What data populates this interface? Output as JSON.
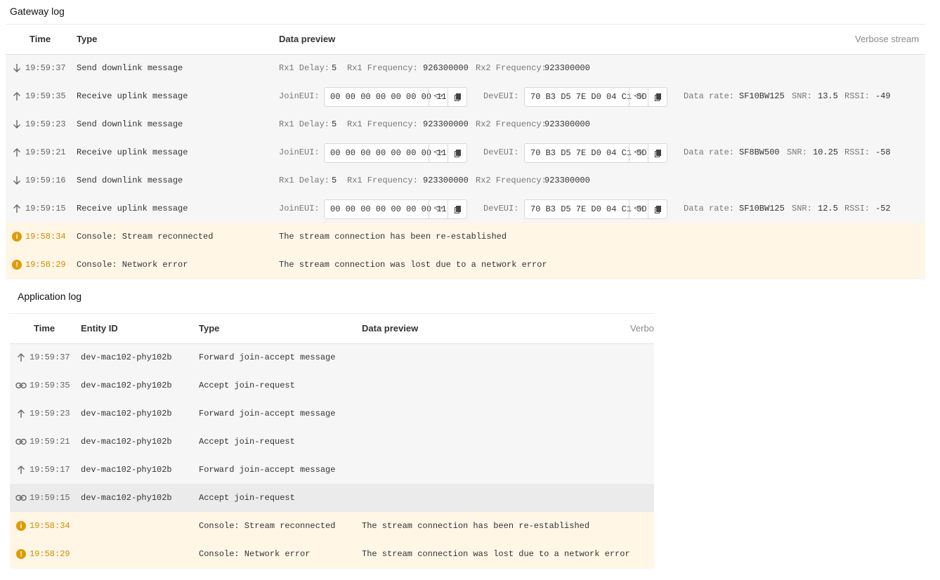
{
  "gateway": {
    "title": "Gateway log",
    "headers": {
      "time": "Time",
      "type": "Type",
      "preview": "Data preview",
      "verbose": "Verbose stream"
    },
    "rows": [
      {
        "icon": "arrow-down-icon",
        "time": "19:59:37",
        "type": "Send downlink message",
        "kind": "down",
        "p": [
          "Rx1 Delay:",
          "5",
          "Rx1 Frequency:",
          "926300000",
          "Rx2 Frequency:",
          "923300000"
        ]
      },
      {
        "icon": "arrow-up-icon",
        "time": "19:59:35",
        "type": "Receive uplink message",
        "kind": "up",
        "join_label": "JoinEUI:",
        "join": "00 00 00 00 00 00 00 11",
        "dev_label": "DevEUI:",
        "dev": "70 B3 D5 7E D0 04 C1 5D",
        "p": [
          "Data rate:",
          "SF10BW125",
          "SNR:",
          "13.5",
          "RSSI:",
          "-49"
        ]
      },
      {
        "icon": "arrow-down-icon",
        "time": "19:59:23",
        "type": "Send downlink message",
        "kind": "down",
        "p": [
          "Rx1 Delay:",
          "5",
          "Rx1 Frequency:",
          "923300000",
          "Rx2 Frequency:",
          "923300000"
        ]
      },
      {
        "icon": "arrow-up-icon",
        "time": "19:59:21",
        "type": "Receive uplink message",
        "kind": "up",
        "join_label": "JoinEUI:",
        "join": "00 00 00 00 00 00 00 11",
        "dev_label": "DevEUI:",
        "dev": "70 B3 D5 7E D0 04 C1 5D",
        "p": [
          "Data rate:",
          "SF8BW500",
          "SNR:",
          "10.25",
          "RSSI:",
          "-58"
        ]
      },
      {
        "icon": "arrow-down-icon",
        "time": "19:59:16",
        "type": "Send downlink message",
        "kind": "down",
        "p": [
          "Rx1 Delay:",
          "5",
          "Rx1 Frequency:",
          "923300000",
          "Rx2 Frequency:",
          "923300000"
        ]
      },
      {
        "icon": "arrow-up-icon",
        "time": "19:59:15",
        "type": "Receive uplink message",
        "kind": "up",
        "join_label": "JoinEUI:",
        "join": "00 00 00 00 00 00 00 11",
        "dev_label": "DevEUI:",
        "dev": "70 B3 D5 7E D0 04 C1 5D",
        "p": [
          "Data rate:",
          "SF10BW125",
          "SNR:",
          "12.5",
          "RSSI:",
          "-52"
        ]
      },
      {
        "icon": "info-icon",
        "time": "19:58:34",
        "type": "Console: Stream reconnected",
        "kind": "warn",
        "text": "The stream connection has been re-established"
      },
      {
        "icon": "error-icon",
        "time": "19:58:29",
        "type": "Console: Network error",
        "kind": "warn",
        "text": "The stream connection was lost due to a network error"
      }
    ]
  },
  "application": {
    "title": "Application log",
    "headers": {
      "time": "Time",
      "entity": "Entity ID",
      "type": "Type",
      "preview": "Data preview",
      "verbose": "Verbo"
    },
    "rows": [
      {
        "icon": "arrow-up-icon",
        "time": "19:59:37",
        "entity": "dev-mac102-phy102b",
        "type": "Forward join-accept message",
        "text": ""
      },
      {
        "icon": "link-icon",
        "time": "19:59:35",
        "entity": "dev-mac102-phy102b",
        "type": "Accept join-request",
        "text": ""
      },
      {
        "icon": "arrow-up-icon",
        "time": "19:59:23",
        "entity": "dev-mac102-phy102b",
        "type": "Forward join-accept message",
        "text": ""
      },
      {
        "icon": "link-icon",
        "time": "19:59:21",
        "entity": "dev-mac102-phy102b",
        "type": "Accept join-request",
        "text": ""
      },
      {
        "icon": "arrow-up-icon",
        "time": "19:59:17",
        "entity": "dev-mac102-phy102b",
        "type": "Forward join-accept message",
        "text": ""
      },
      {
        "icon": "link-icon",
        "time": "19:59:15",
        "entity": "dev-mac102-phy102b",
        "type": "Accept join-request",
        "text": "",
        "highlight": true
      },
      {
        "icon": "info-icon",
        "time": "19:58:34",
        "entity": "",
        "type": "Console: Stream reconnected",
        "text": "The stream connection has been re-established",
        "warn": true
      },
      {
        "icon": "error-icon",
        "time": "19:58:29",
        "entity": "",
        "type": "Console: Network error",
        "text": "The stream connection was lost due to a network error",
        "warn": true
      }
    ]
  },
  "colors": {
    "warning": "#e09b00",
    "warn_bg": "#fff6e6",
    "panel_bg": "#f6f6f6"
  }
}
